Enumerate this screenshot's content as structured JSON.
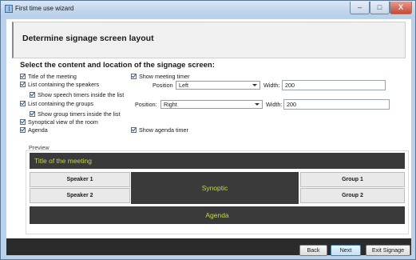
{
  "window": {
    "title": "First time use wizard",
    "minimize": "–",
    "maximize": "□",
    "close": "X"
  },
  "page": {
    "title": "Determine signage screen layout",
    "section_title": "Select the content and location of the signage screen:"
  },
  "options": {
    "title_of_meeting": {
      "label": "Title of the meeting",
      "checked": true
    },
    "show_meeting_timer": {
      "label": "Show meeting timer",
      "checked": true
    },
    "list_speakers": {
      "label": "List containing the speakers",
      "checked": true
    },
    "speakers_position_label": "Position",
    "speakers_position_value": "Left",
    "speakers_width_label": "Width:",
    "speakers_width_value": "200",
    "show_speech_timers": {
      "label": "Show speech timers inside the list",
      "checked": true
    },
    "list_groups": {
      "label": "List containing the groups",
      "checked": true
    },
    "groups_position_label": "Position:",
    "groups_position_value": "Right",
    "groups_width_label": "Width:",
    "groups_width_value": "200",
    "show_group_timers": {
      "label": "Show group timers inside the list",
      "checked": true
    },
    "synoptical_view": {
      "label": "Synoptical view of the room",
      "checked": true
    },
    "agenda": {
      "label": "Agenda",
      "checked": true
    },
    "show_agenda_timer": {
      "label": "Show agenda timer",
      "checked": true
    }
  },
  "preview": {
    "label": "Preview",
    "title": "Title of the meeting",
    "speakers": [
      "Speaker 1",
      "Speaker 2"
    ],
    "synoptic": "Synoptic",
    "groups": [
      "Group 1",
      "Group 2"
    ],
    "agenda": "Agenda",
    "accent_color": "#c9d92f",
    "panel_color": "#3a3a3a"
  },
  "footer": {
    "back": "Back",
    "next": "Next",
    "exit": "Exit Signage"
  }
}
